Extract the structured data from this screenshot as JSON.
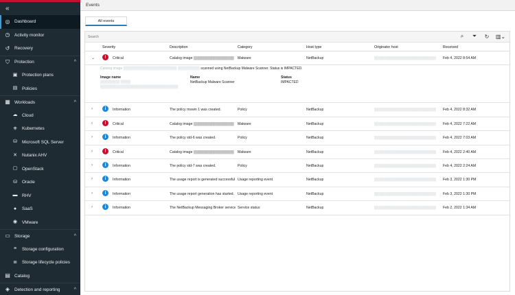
{
  "sidebar": {
    "collapse_icon": "«",
    "items": [
      {
        "label": "Dashboard",
        "icon": "dashboard-icon",
        "glyph": "◎",
        "active": true
      },
      {
        "label": "Activity monitor",
        "icon": "activity-icon",
        "glyph": "◷"
      },
      {
        "label": "Recovery",
        "icon": "recovery-icon",
        "glyph": "↺"
      },
      {
        "label": "Protection",
        "icon": "shield-icon",
        "glyph": "⛉",
        "chevron": "^"
      },
      {
        "label": "Protection plans",
        "icon": "plans-icon",
        "glyph": "▣",
        "sub": true
      },
      {
        "label": "Policies",
        "icon": "policies-icon",
        "glyph": "▤",
        "sub": true
      },
      {
        "label": "Workloads",
        "icon": "workloads-icon",
        "glyph": "▦",
        "chevron": "^"
      },
      {
        "label": "Cloud",
        "icon": "cloud-icon",
        "glyph": "☁",
        "sub": true
      },
      {
        "label": "Kubernetes",
        "icon": "kubernetes-icon",
        "glyph": "⎈",
        "sub": true
      },
      {
        "label": "Microsoft SQL Server",
        "icon": "sql-server-icon",
        "glyph": "⛁",
        "sub": true
      },
      {
        "label": "Nutanix AHV",
        "icon": "nutanix-icon",
        "glyph": "✕",
        "sub": true
      },
      {
        "label": "OpenStack",
        "icon": "openstack-icon",
        "glyph": "▢",
        "sub": true
      },
      {
        "label": "Oracle",
        "icon": "oracle-icon",
        "glyph": "⛁",
        "sub": true
      },
      {
        "label": "RHV",
        "icon": "rhv-icon",
        "glyph": "▬",
        "sub": true
      },
      {
        "label": "SaaS",
        "icon": "saas-icon",
        "glyph": "●",
        "sub": true
      },
      {
        "label": "VMware",
        "icon": "vmware-icon",
        "glyph": "◉",
        "sub": true
      },
      {
        "label": "Storage",
        "icon": "storage-icon",
        "glyph": "▭",
        "chevron": "^"
      },
      {
        "label": "Storage configuration",
        "icon": "storage-config-icon",
        "glyph": "≡",
        "sub": true
      },
      {
        "label": "Storage lifecycle policies",
        "icon": "lifecycle-icon",
        "glyph": "≣",
        "sub": true
      },
      {
        "label": "Catalog",
        "icon": "catalog-icon",
        "glyph": "▤"
      },
      {
        "label": "Detection and reporting",
        "icon": "detection-icon",
        "glyph": "◈",
        "chevron": "^"
      }
    ]
  },
  "header": {
    "title": "Events"
  },
  "tabs": [
    {
      "label": "All events"
    }
  ],
  "search": {
    "placeholder": "Search"
  },
  "toolbar": {
    "search_icon": "⌕",
    "filter_icon": "⏷",
    "refresh_icon": "↻",
    "columns_icon": "▥⌄"
  },
  "table": {
    "columns": [
      "Severity",
      "Description",
      "Category",
      "Host type",
      "Originator host",
      "Received"
    ],
    "rows": [
      {
        "severity": "Critical",
        "sev": "critical",
        "description": "Catalog image ▒▒▒▒▒▒▒▒▒▒▒▒▒▒▒▒",
        "category": "Malware",
        "host_type": "NetBackup",
        "originator": "▒▒▒▒▒▒▒▒▒▒▒▒▒▒▒▒▒▒▒▒▒▒▒▒▒",
        "received": "Feb 4, 2022 8:54 AM",
        "expanded": true
      },
      {
        "severity": "Information",
        "sev": "info",
        "description": "The policy mswin 1 was created.",
        "category": "Policy",
        "host_type": "NetBackup",
        "originator": "▒▒▒▒▒▒▒▒▒▒▒▒▒▒▒▒▒▒▒▒▒▒▒▒▒",
        "received": "Feb 4, 2022 8:32 AM"
      },
      {
        "severity": "Critical",
        "sev": "critical",
        "description": "Catalog image ▒▒▒▒▒▒▒▒▒▒▒▒▒▒▒▒",
        "category": "Malware",
        "host_type": "NetBackup",
        "originator": "▒▒▒▒▒▒▒▒▒▒▒▒▒▒▒▒▒▒▒▒▒▒▒▒▒",
        "received": "Feb 4, 2022 7:22 AM"
      },
      {
        "severity": "Information",
        "sev": "info",
        "description": "The policy std-6 was created.",
        "category": "Policy",
        "host_type": "NetBackup",
        "originator": "▒▒▒▒▒▒▒▒▒▒▒▒▒▒▒▒▒▒▒▒▒▒▒▒▒",
        "received": "Feb 4, 2022 7:03 AM"
      },
      {
        "severity": "Critical",
        "sev": "critical",
        "description": "Catalog image ▒▒▒▒▒▒▒▒▒▒▒▒▒▒▒▒",
        "category": "Malware",
        "host_type": "NetBackup",
        "originator": "▒▒▒▒▒▒▒▒▒▒▒▒▒▒▒▒▒▒▒▒▒▒▒▒▒",
        "received": "Feb 4, 2022 2:40 AM"
      },
      {
        "severity": "Information",
        "sev": "info",
        "description": "The policy std-7 was created.",
        "category": "Policy",
        "host_type": "NetBackup",
        "originator": "▒▒▒▒▒▒▒▒▒▒▒▒▒▒▒▒▒▒▒▒▒▒▒▒▒",
        "received": "Feb 4, 2022 2:24 AM"
      },
      {
        "severity": "Information",
        "sev": "info",
        "description": "The usage report is generated successful",
        "category": "Usage reporting event",
        "host_type": "NetBackup",
        "originator": "▒▒▒▒▒▒▒▒▒▒▒▒▒▒▒▒▒▒▒▒▒▒▒▒▒",
        "received": "Feb 3, 2022 1:30 PM"
      },
      {
        "severity": "Information",
        "sev": "info",
        "description": "The usage report generation has started.",
        "category": "Usage reporting event",
        "host_type": "NetBackup",
        "originator": "▒▒▒▒▒▒▒▒▒▒▒▒▒▒▒▒▒▒▒▒▒▒▒▒▒",
        "received": "Feb 3, 2022 1:30 PM"
      },
      {
        "severity": "Information",
        "sev": "info",
        "description": "The NetBackup Messaging Broker service",
        "category": "Service status",
        "host_type": "NetBackup",
        "originator": "▒▒▒▒▒▒▒▒▒▒▒▒▒▒▒▒▒▒▒▒▒▒▒▒▒",
        "received": "Feb 2, 2022 1:34 AM"
      }
    ],
    "details": {
      "message_prefix": "Catalog image ▒▒▒▒▒▒▒▒▒▒▒▒▒▒▒▒▒▒▒▒▒▒ ▒▒▒▒▒▒▒▒▒",
      "message_suffix": "scanned using NetBackup Malware Scanner. Status is IMPACTED.",
      "image_name_label": "Image name",
      "image_name_value": "▒▒▒▒▒▒▒▒ ▒▒▒▒",
      "image_name_value2": "▒▒▒▒▒▒▒▒▒▒▒▒▒▒▒▒▒▒▒▒▒▒▒▒▒▒▒▒▒▒▒▒",
      "name_label": "Name",
      "name_value": "NetBackup Malware Scanner",
      "status_label": "Status",
      "status_value": "IMPACTED"
    }
  },
  "colors": {
    "critical": "#c8102e",
    "info": "#1e88d6",
    "accent": "#2b7bbf",
    "sidebar": "#1f2b33"
  }
}
